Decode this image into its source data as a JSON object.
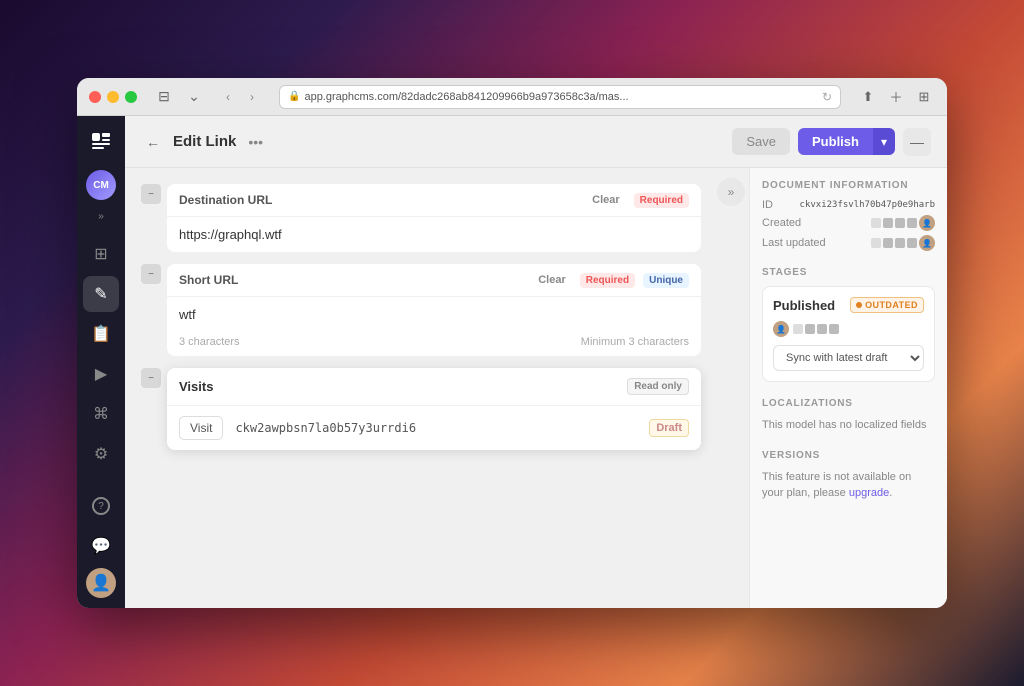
{
  "window": {
    "traffic_lights": [
      "red",
      "yellow",
      "green"
    ],
    "address": "app.graphcms.com/82dadc268ab841209966b9a973658c3a/mas...",
    "address_icon": "🔒"
  },
  "sidebar": {
    "logo_text": "G",
    "avatar_initials": "CM",
    "items": [
      {
        "id": "layers",
        "icon": "⊞",
        "active": false
      },
      {
        "id": "edit",
        "icon": "✏️",
        "active": true
      },
      {
        "id": "document",
        "icon": "📄",
        "active": false
      },
      {
        "id": "play",
        "icon": "▶",
        "active": false
      },
      {
        "id": "webhook",
        "icon": "⌘",
        "active": false
      },
      {
        "id": "settings",
        "icon": "⚙",
        "active": false
      },
      {
        "id": "help",
        "icon": "?",
        "active": false
      },
      {
        "id": "chat",
        "icon": "💬",
        "active": false
      }
    ]
  },
  "topbar": {
    "back_icon": "←",
    "title": "Edit Link",
    "more_icon": "•••",
    "save_label": "Save",
    "publish_label": "Publish",
    "publish_arrow": "▾",
    "collapse_icon": "—"
  },
  "fields": {
    "destination_url": {
      "label": "Destination URL",
      "clear_label": "Clear",
      "required_label": "Required",
      "value": "https://graphql.wtf",
      "placeholder": ""
    },
    "short_url": {
      "label": "Short URL",
      "clear_label": "Clear",
      "required_label": "Required",
      "unique_label": "Unique",
      "value": "wtf",
      "char_count": "3 characters",
      "min_chars": "Minimum 3 characters"
    },
    "visits": {
      "label": "Visits",
      "readonly_label": "Read only",
      "visit_btn_label": "Visit",
      "visit_id": "ckw2awpbsn7la0b57y3urrdi6",
      "draft_label": "Draft"
    }
  },
  "right_panel": {
    "document_info": {
      "section_title": "DOCUMENT INFORMATION",
      "id_label": "ID",
      "id_value": "ckvxi23fsvlh70b47p0e9harb",
      "created_label": "Created",
      "last_updated_label": "Last updated"
    },
    "stages": {
      "section_title": "STAGES",
      "published_label": "Published",
      "outdated_label": "OUTDATED",
      "sync_label": "Sync with latest draft"
    },
    "localizations": {
      "section_title": "LOCALIZATIONS",
      "message": "This model has no localized fields"
    },
    "versions": {
      "section_title": "VERSIONS",
      "message": "This feature is not available on your plan, please ",
      "upgrade_label": "upgrade",
      "upgrade_suffix": "."
    }
  }
}
